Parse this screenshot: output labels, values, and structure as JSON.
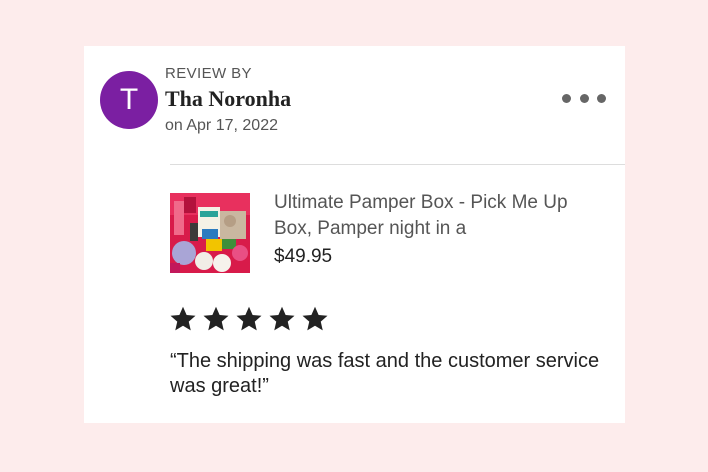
{
  "review": {
    "avatar_initial": "T",
    "avatar_color": "#7b1fa2",
    "label": "REVIEW BY",
    "reviewer_name": "Tha Noronha",
    "date": "on Apr 17, 2022",
    "more_icon": "ellipsis-icon"
  },
  "product": {
    "title": "Ultimate Pamper Box - Pick Me Up Box, Pamper night in a",
    "price": "$49.95"
  },
  "rating": {
    "stars": 5,
    "max": 5
  },
  "review_text": "“The shipping was fast and the customer service was great!”"
}
